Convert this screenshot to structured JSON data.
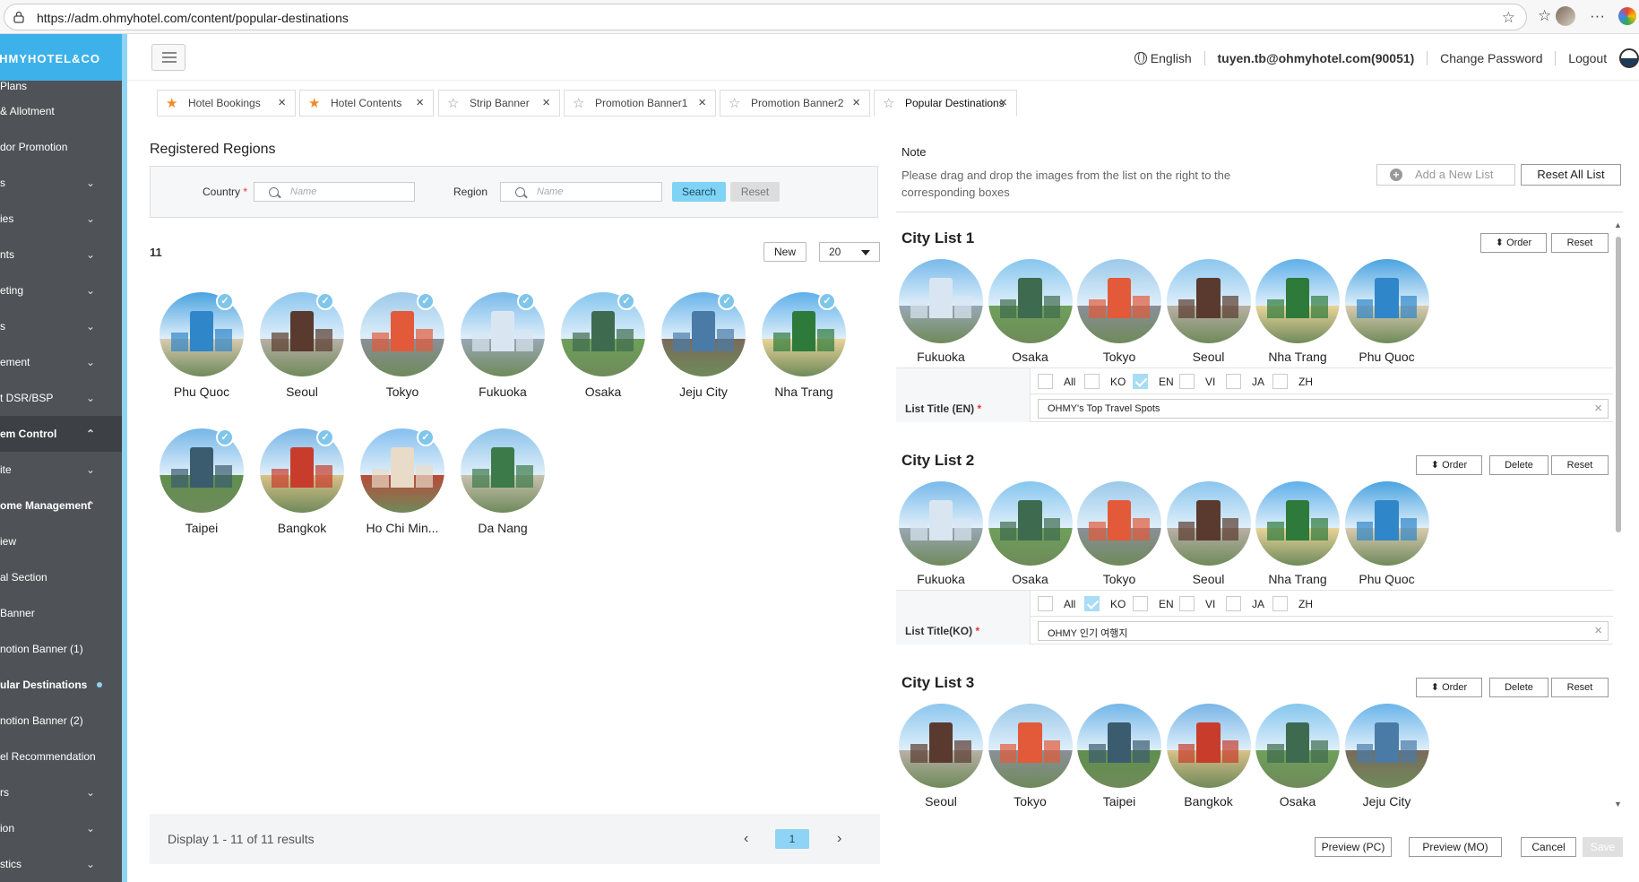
{
  "browser": {
    "url": "https://adm.ohmyhotel.com/content/popular-destinations"
  },
  "sidebar": {
    "logo": "OHMYHOTEL&CO",
    "items": [
      {
        "label": "Plans",
        "chevron": false,
        "style": "plans"
      },
      {
        "label": "& Allotment",
        "chevron": false
      },
      {
        "label": "dor Promotion",
        "chevron": false
      },
      {
        "label": "s",
        "chevron": true
      },
      {
        "label": "ies",
        "chevron": true
      },
      {
        "label": "nts",
        "chevron": true
      },
      {
        "label": "eting",
        "chevron": true
      },
      {
        "label": "s",
        "chevron": true
      },
      {
        "label": "ement",
        "chevron": true
      },
      {
        "label": "t DSR/BSP",
        "chevron": true
      },
      {
        "label": "em Control",
        "chevron": true,
        "style": "active",
        "chevron_up": true
      },
      {
        "label": "ite",
        "chevron": true
      },
      {
        "label": "ome Management",
        "chevron": true,
        "style": "current-parent",
        "chevron_up": true
      },
      {
        "label": "iew",
        "chevron": false
      },
      {
        "label": "al Section",
        "chevron": false
      },
      {
        "label": "Banner",
        "chevron": false
      },
      {
        "label": "notion Banner (1)",
        "chevron": false
      },
      {
        "label": "ular Destinations",
        "chevron": false,
        "style": "current"
      },
      {
        "label": "notion Banner (2)",
        "chevron": false
      },
      {
        "label": "el Recommendation",
        "chevron": false
      },
      {
        "label": "rs",
        "chevron": true
      },
      {
        "label": "ion",
        "chevron": true
      },
      {
        "label": "stics",
        "chevron": true
      }
    ]
  },
  "header": {
    "language": "English",
    "user": "tuyen.tb@ohmyhotel.com(90051)",
    "change_password": "Change Password",
    "logout": "Logout"
  },
  "tabs": [
    {
      "label": "Hotel Bookings",
      "starred": true
    },
    {
      "label": "Hotel Contents",
      "starred": true
    },
    {
      "label": "Strip Banner",
      "starred": false
    },
    {
      "label": "Promotion Banner1",
      "starred": false
    },
    {
      "label": "Promotion Banner2",
      "starred": false
    },
    {
      "label": "Popular Destinations",
      "starred": false,
      "active": true
    }
  ],
  "left": {
    "title": "Registered Regions",
    "country_label": "Country",
    "country_placeholder": "Name",
    "region_label": "Region",
    "region_placeholder": "Name",
    "search_btn": "Search",
    "reset_btn": "Reset",
    "count": "11",
    "new_btn": "New",
    "page_size": "20",
    "regions": [
      "Phu Quoc",
      "Seoul",
      "Tokyo",
      "Fukuoka",
      "Osaka",
      "Jeju City",
      "Nha Trang",
      "Taipei",
      "Bangkok",
      "Ho Chi Min...",
      "Da Nang"
    ],
    "checked_count": 10,
    "display_text": "Display 1 - 11 of 11 results",
    "page": "1"
  },
  "right": {
    "note_title": "Note",
    "note_text": "Please drag and drop the images from the list on the right to the corresponding boxes",
    "add_list_btn": "Add a New List",
    "reset_all_btn": "Reset All List",
    "order_btn": "Order",
    "delete_btn": "Delete",
    "reset_btn": "Reset",
    "languages": [
      "All",
      "KO",
      "EN",
      "VI",
      "JA",
      "ZH"
    ],
    "lists": [
      {
        "title": "City List 1",
        "cities": [
          "Fukuoka",
          "Osaka",
          "Tokyo",
          "Seoul",
          "Nha Trang",
          "Phu Quoc"
        ],
        "checked_lang": "EN",
        "title_label": "List Title (EN)",
        "title_value": "OHMY's Top Travel Spots",
        "deletable": false
      },
      {
        "title": "City List 2",
        "cities": [
          "Fukuoka",
          "Osaka",
          "Tokyo",
          "Seoul",
          "Nha Trang",
          "Phu Quoc"
        ],
        "checked_lang": "KO",
        "title_label": "List Title(KO)",
        "title_value": "OHMY 인기 여행지",
        "deletable": true
      },
      {
        "title": "City List 3",
        "cities": [
          "Seoul",
          "Tokyo",
          "Taipei",
          "Bangkok",
          "Osaka",
          "Jeju City"
        ],
        "deletable": true
      }
    ],
    "preview_pc": "Preview (PC)",
    "preview_mo": "Preview (MO)",
    "cancel": "Cancel",
    "save": "Save"
  },
  "colors": {
    "accent": "#3db1ea",
    "sidebar_bg": "#4f5357",
    "check": "#7fc6ea",
    "primary_btn": "#7fd3f5"
  }
}
